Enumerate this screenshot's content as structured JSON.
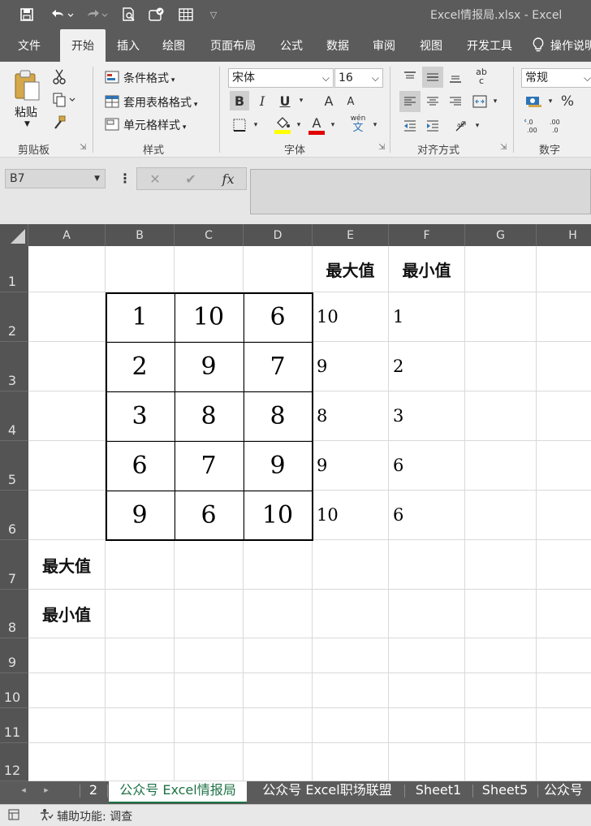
{
  "window": {
    "title": "Excel情报局.xlsx  -  Excel"
  },
  "quick_access": {
    "save_icon": "save-icon",
    "undo_icon": "undo-icon",
    "redo_icon": "redo-icon",
    "print_preview_icon": "print-preview-icon",
    "customize_icon": "customize-icon"
  },
  "ribbon_tabs": [
    "文件",
    "开始",
    "插入",
    "绘图",
    "页面布局",
    "公式",
    "数据",
    "审阅",
    "视图",
    "开发工具",
    "操作说明搜索"
  ],
  "active_tab": "开始",
  "ribbon": {
    "clipboard": {
      "paste_label": "粘贴",
      "group_label": "剪贴板"
    },
    "styles": {
      "conditional_format": "条件格式",
      "table_format": "套用表格格式",
      "cell_styles": "单元格样式",
      "group_label": "样式"
    },
    "font": {
      "font_name": "宋体",
      "font_size": "16",
      "bold": "B",
      "italic": "I",
      "underline": "U",
      "grow": "A",
      "shrink": "A",
      "font_color": "A",
      "phonetic": "wén",
      "phonetic_char": "文",
      "group_label": "字体"
    },
    "alignment": {
      "wrap": "ab",
      "wrap_c": "c",
      "group_label": "对齐方式"
    },
    "number": {
      "format": "常规",
      "percent": "%",
      "inc_decimal": "←.0\n.00",
      "group_label": "数字"
    }
  },
  "formula_bar": {
    "name_box": "B7",
    "fx_label": "fx",
    "cancel": "✕",
    "confirm": "✔",
    "more": "⋮",
    "formula": ""
  },
  "sheet": {
    "columns": [
      "A",
      "B",
      "C",
      "D",
      "E",
      "F",
      "G",
      "H"
    ],
    "rows": [
      "1",
      "2",
      "3",
      "4",
      "5",
      "6",
      "7",
      "8",
      "9",
      "10",
      "11",
      "12"
    ],
    "header_e1": "最大值",
    "header_f1": "最小值",
    "matrix": [
      [
        "1",
        "10",
        "6"
      ],
      [
        "2",
        "9",
        "7"
      ],
      [
        "3",
        "8",
        "8"
      ],
      [
        "6",
        "7",
        "9"
      ],
      [
        "9",
        "6",
        "10"
      ]
    ],
    "row_max": [
      "10",
      "9",
      "8",
      "9",
      "10"
    ],
    "row_min": [
      "1",
      "2",
      "3",
      "6",
      "6"
    ],
    "label_a7": "最大值",
    "label_a8": "最小值"
  },
  "sheet_tabs": [
    "2",
    "公众号 Excel情报局",
    "公众号 Excel职场联盟",
    "Sheet1",
    "Sheet5",
    "公众号"
  ],
  "active_sheet": "公众号 Excel情报局",
  "status": {
    "accessibility": "辅助功能: 调查"
  }
}
